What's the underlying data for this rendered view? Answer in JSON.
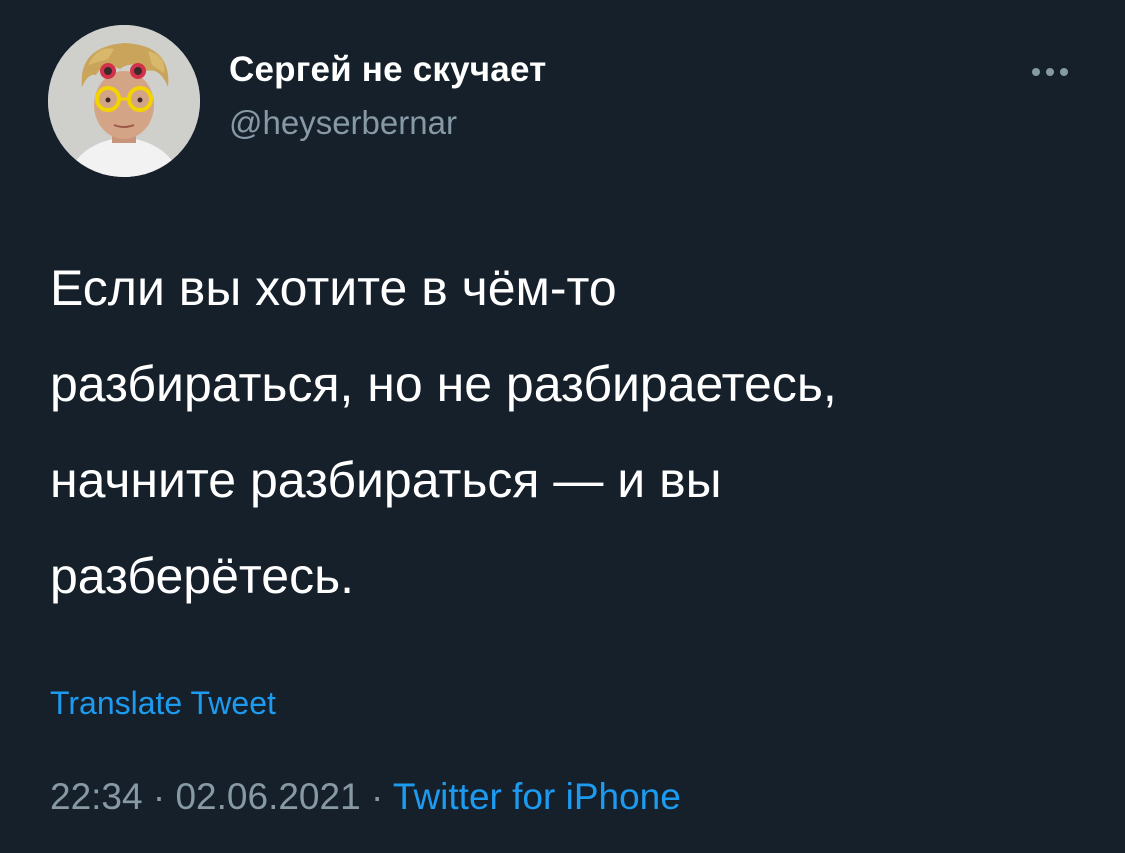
{
  "tweet": {
    "author": {
      "name": "Сергей не скучает",
      "handle": "@heyserbernar"
    },
    "text_lines": [
      "Если вы хотите в чём-то",
      "разбираться, но не разбираетесь,",
      "начните разбираться — и вы",
      "разберётесь."
    ],
    "translate_label": "Translate Tweet",
    "time": "22:34",
    "separator": "·",
    "date": "02.06.2021",
    "source": "Twitter for iPhone"
  },
  "icons": {
    "more": "more-options-icon",
    "avatar": "profile-photo"
  },
  "colors": {
    "background": "#15202b",
    "primary_text": "#ffffff",
    "secondary_text": "#8899a6",
    "link": "#1d9bf0"
  }
}
